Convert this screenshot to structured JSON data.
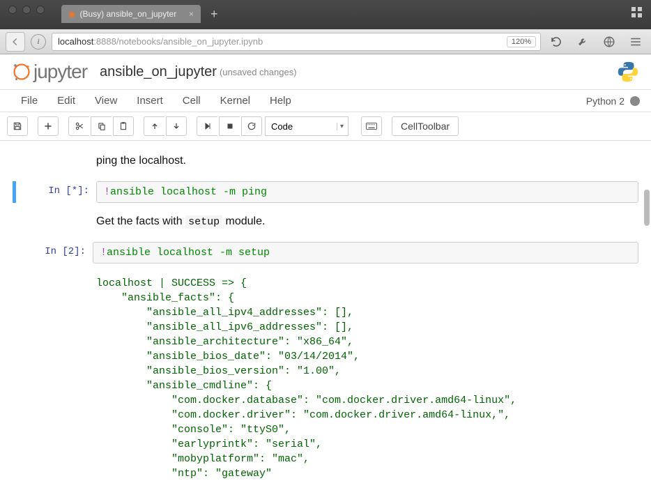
{
  "browser": {
    "tab_title": "(Busy) ansible_on_jupyter",
    "url_host": "localhost",
    "url_port": ":8888",
    "url_path": "/notebooks/ansible_on_jupyter.ipynb",
    "zoom": "120%"
  },
  "header": {
    "logo_text": "jupyter",
    "notebook_name": "ansible_on_jupyter",
    "status": "(unsaved changes)"
  },
  "menubar": {
    "items": [
      "File",
      "Edit",
      "View",
      "Insert",
      "Cell",
      "Kernel",
      "Help"
    ],
    "kernel_name": "Python 2"
  },
  "toolbar": {
    "cell_type": "Code",
    "cell_toolbar": "CellToolbar"
  },
  "notebook": {
    "md1": "ping the localhost.",
    "md2_prefix": "Get the facts with ",
    "md2_code": "setup",
    "md2_suffix": " module.",
    "cell1": {
      "prompt": "In [*]:",
      "bang": "!",
      "code": "ansible localhost -m ping"
    },
    "cell2": {
      "prompt": "In [2]:",
      "bang": "!",
      "code": "ansible localhost -m setup",
      "output": "localhost | SUCCESS => {\n    \"ansible_facts\": {\n        \"ansible_all_ipv4_addresses\": [],\n        \"ansible_all_ipv6_addresses\": [],\n        \"ansible_architecture\": \"x86_64\",\n        \"ansible_bios_date\": \"03/14/2014\",\n        \"ansible_bios_version\": \"1.00\",\n        \"ansible_cmdline\": {\n            \"com.docker.database\": \"com.docker.driver.amd64-linux\",\n            \"com.docker.driver\": \"com.docker.driver.amd64-linux,\",\n            \"console\": \"ttyS0\",\n            \"earlyprintk\": \"serial\",\n            \"mobyplatform\": \"mac\",\n            \"ntp\": \"gateway\""
    }
  }
}
